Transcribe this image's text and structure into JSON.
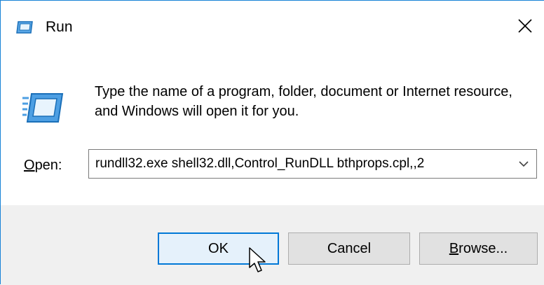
{
  "window": {
    "title": "Run"
  },
  "dialog": {
    "description": "Type the name of a program, folder, document or Internet resource, and Windows will open it for you.",
    "open_label_mnemonic": "O",
    "open_label_rest": "pen:",
    "open_value": "rundll32.exe shell32.dll,Control_RunDLL bthprops.cpl,,2"
  },
  "buttons": {
    "ok": "OK",
    "cancel": "Cancel",
    "browse_mnemonic": "B",
    "browse_rest": "rowse..."
  },
  "icons": {
    "title": "run-icon",
    "main": "run-icon",
    "close": "close-icon",
    "dropdown": "chevron-down-icon",
    "cursor": "mouse-pointer-icon"
  },
  "colors": {
    "accent": "#0078d7",
    "footer_bg": "#f0f0f0",
    "button_bg": "#e1e1e1"
  }
}
